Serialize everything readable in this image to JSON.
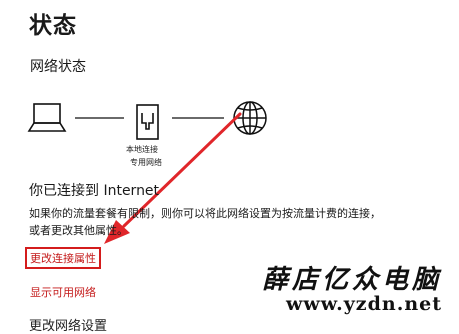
{
  "header": {
    "title": "状态"
  },
  "section": {
    "title": "网络状态"
  },
  "diagram": {
    "computer_icon": "laptop-icon",
    "adapter_icon": "ethernet-icon",
    "internet_icon": "globe-icon",
    "adapter_label_line1": "本地连接",
    "adapter_label_line2": "专用网络"
  },
  "status": {
    "heading": "你已连接到 Internet",
    "description": "如果你的流量套餐有限制，则你可以将此网络设置为按流量计费的连接，或者更改其他属性。"
  },
  "links": {
    "change_properties": "更改连接属性",
    "show_networks": "显示可用网络",
    "next_section": "更改网络设置"
  },
  "annotation": {
    "arrow_color": "#e0262a",
    "highlight_color": "#d41c1c"
  },
  "watermark": {
    "name": "薛店亿众电脑",
    "url": "www.yzdn.net"
  },
  "colors": {
    "link": "#c41a1a",
    "background": "#ffffff",
    "text": "#1a1a1a"
  }
}
